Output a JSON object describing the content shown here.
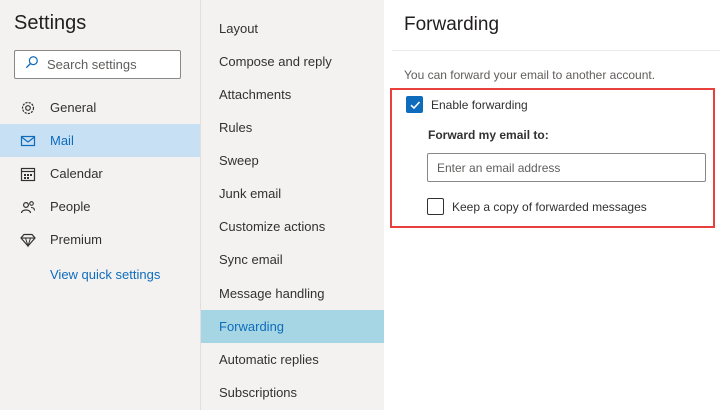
{
  "left": {
    "title": "Settings",
    "search_placeholder": "Search settings",
    "nav_items": [
      {
        "label": "General",
        "icon": "gear-icon"
      },
      {
        "label": "Mail",
        "icon": "mail-icon"
      },
      {
        "label": "Calendar",
        "icon": "calendar-icon"
      },
      {
        "label": "People",
        "icon": "people-icon"
      },
      {
        "label": "Premium",
        "icon": "diamond-icon"
      }
    ],
    "selected": "Mail",
    "quick_settings_link": "View quick settings"
  },
  "middle": {
    "items": [
      "Layout",
      "Compose and reply",
      "Attachments",
      "Rules",
      "Sweep",
      "Junk email",
      "Customize actions",
      "Sync email",
      "Message handling",
      "Forwarding",
      "Automatic replies",
      "Subscriptions"
    ],
    "selected": "Forwarding"
  },
  "right": {
    "title": "Forwarding",
    "description": "You can forward your email to another account.",
    "enable_forwarding": {
      "label": "Enable forwarding",
      "checked": true
    },
    "forward_to_label": "Forward my email to:",
    "email_placeholder": "Enter an email address",
    "keep_copy": {
      "label": "Keep a copy of forwarded messages",
      "checked": false
    }
  },
  "colors": {
    "accent": "#0f6cbd",
    "selected_nav_bg": "#c7e0f4",
    "selected_sub_bg": "#a6d6e4",
    "highlight_border": "#e8413c",
    "pane_bg": "#f3f2f1"
  }
}
